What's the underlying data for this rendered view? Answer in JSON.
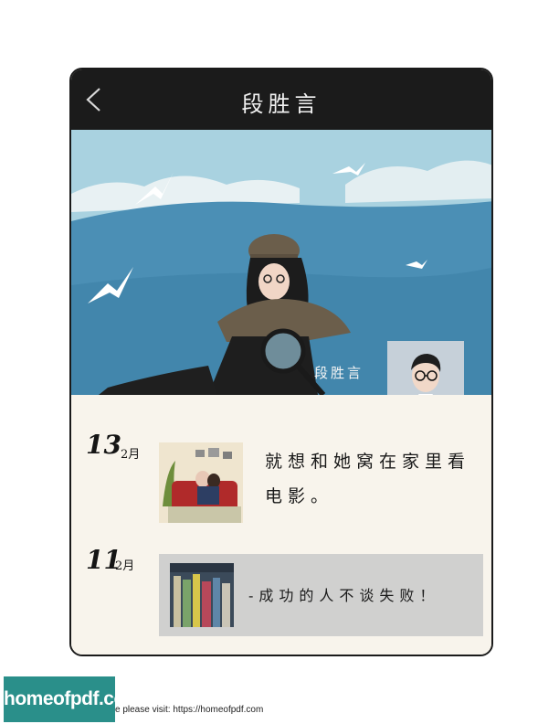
{
  "header": {
    "title": "段胜言",
    "back_icon": "chevron-left-icon"
  },
  "banner": {
    "overlay_name": "段胜言"
  },
  "posts": [
    {
      "day": "13",
      "month": "2月",
      "text": "就想和她窝在家里看电影。"
    },
    {
      "day": "11",
      "month": "2月",
      "text": "-成功的人不谈失败！"
    }
  ],
  "footer": {
    "logo": "homeofpdf.com",
    "notice": "e please visit: https://homeofpdf.com"
  },
  "colors": {
    "titlebar": "#1b1b1b",
    "sky": "#a9d2e0",
    "sea": "#4b8fb5",
    "card": "#d0d0cf",
    "logo_bg": "#2a8f8a"
  }
}
